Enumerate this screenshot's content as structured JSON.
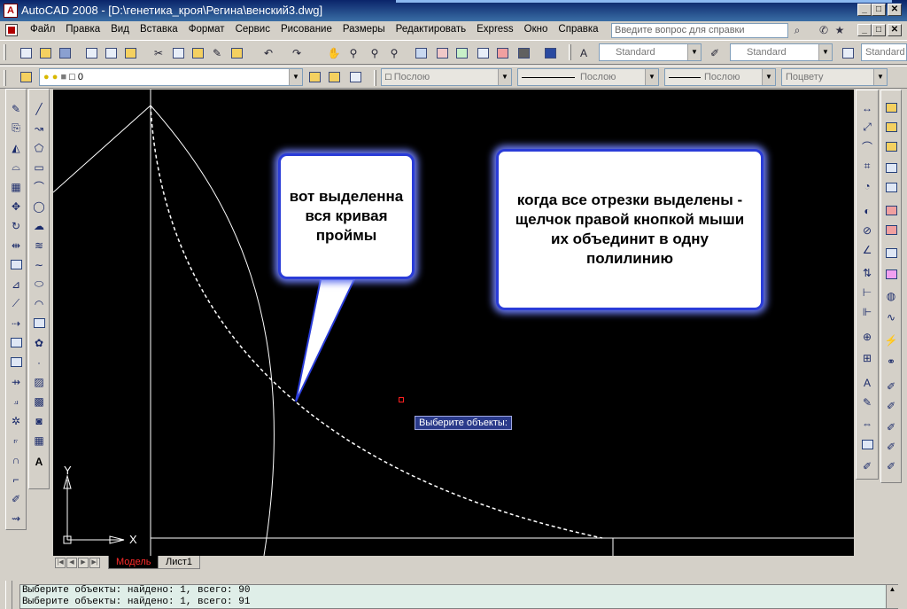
{
  "window": {
    "title": "AutoCAD 2008 - [D:\\генетика_кроя\\Регина\\венский3.dwg]",
    "app_icon": "autocad-logo",
    "controls": [
      "_",
      "□",
      "✕"
    ]
  },
  "menu": {
    "items": [
      "Файл",
      "Правка",
      "Вид",
      "Вставка",
      "Формат",
      "Сервис",
      "Рисование",
      "Размеры",
      "Редактировать",
      "Express",
      "Окно",
      "Справка"
    ],
    "help_search_placeholder": "Введите вопрос для справки"
  },
  "toolbar_styles": {
    "text_style": "Standard",
    "dim_style": "Standard",
    "table_style": "Standard"
  },
  "layers_toolbar": {
    "layer_value": "0",
    "color": "Послою",
    "linetype": "Послою",
    "lineweight": "Послою",
    "plot_style": "Поцвету"
  },
  "drawing": {
    "background": "#000000",
    "callouts": {
      "left": "вот выделенна вся кривая проймы",
      "right": "когда все отрезки выделены - щелчок правой кнопкой мыши их объединит в одну полилинию"
    },
    "prompt_tooltip": "Выберите объекты:",
    "ucs": {
      "x_label": "X",
      "y_label": "Y"
    },
    "accent_color": "#2a3cd8"
  },
  "layout_tabs": {
    "items": [
      "Модель",
      "Лист1"
    ],
    "active": "Модель"
  },
  "command_line": {
    "lines": [
      "Выберите объекты: найдено: 1, всего: 90",
      "Выберите объекты: найдено: 1, всего: 91"
    ]
  }
}
